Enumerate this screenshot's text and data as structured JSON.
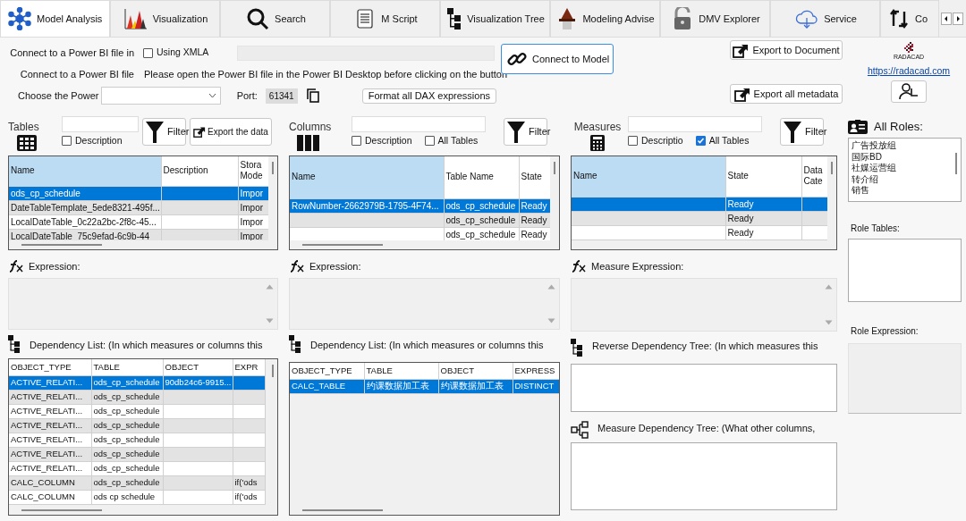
{
  "tabs": [
    {
      "label": "Model Analysis",
      "selected": true
    },
    {
      "label": "Visualization",
      "selected": false
    },
    {
      "label": "Search",
      "selected": false
    },
    {
      "label": "M Script",
      "selected": false
    },
    {
      "label": "Visualization Tree",
      "selected": false
    },
    {
      "label": "Modeling Advise",
      "selected": false
    },
    {
      "label": "DMV Explorer",
      "selected": false
    },
    {
      "label": "Service",
      "selected": false
    },
    {
      "label": "Co",
      "selected": false
    }
  ],
  "connection": {
    "file_in_label": "Connect to a Power BI file in",
    "xmla": {
      "label": "Using XMLA",
      "checked": false
    },
    "file_label": "Connect to a Power BI file",
    "instruction": "Please open the Power BI file in the Power BI Desktop before clicking on the button",
    "choose_label": "Choose the Power",
    "port_label": "Port:",
    "port": "61341",
    "connect_button": "Connect to Model",
    "format_button": "Format all DAX expressions"
  },
  "export": {
    "document_button": "Export to Document",
    "metadata_button": "Export all metadata"
  },
  "logo": {
    "text": "RADACAD",
    "link": "https://radacad.com"
  },
  "tables": {
    "label": "Tables",
    "checkboxes": [
      {
        "label": "Description",
        "checked": false
      }
    ],
    "buttons": [
      {
        "kind": "filter",
        "label": "Filter"
      },
      {
        "kind": "export",
        "label": "Export the data"
      }
    ],
    "grid": {
      "columns": [
        {
          "label": "Name",
          "highlighted": true
        },
        {
          "label": "Description",
          "highlighted": false
        },
        {
          "label": "Stora Mode",
          "highlighted": false
        }
      ],
      "rows": [
        {
          "cells": [
            "ods_cp_schedule",
            null,
            "Impor"
          ],
          "selected": true
        },
        {
          "cells": [
            "DateTableTemplate_5ede8321-495f...",
            null,
            "Impor"
          ],
          "selected": false
        },
        {
          "cells": [
            "LocalDateTable_0c22a2bc-2f8c-45...",
            null,
            "Impor"
          ],
          "selected": false
        },
        {
          "cells": [
            "LocalDateTable_75c9efad-6c9b-44",
            null,
            "Impor"
          ],
          "selected": false
        }
      ]
    },
    "expression_label": "Expression:",
    "dependency": {
      "label": "Dependency List: (In which measures or columns this",
      "grid": {
        "columns": [
          {
            "label": "OBJECT_TYPE",
            "highlighted": false
          },
          {
            "label": "TABLE",
            "highlighted": false
          },
          {
            "label": "OBJECT",
            "highlighted": false
          },
          {
            "label": "EXPR",
            "highlighted": false
          }
        ],
        "rows": [
          {
            "cells": [
              "ACTIVE_RELATI...",
              "ods_cp_schedule",
              "90db24c6-9915...",
              null
            ],
            "selected": true
          },
          {
            "cells": [
              "ACTIVE_RELATI...",
              "ods_cp_schedule",
              null,
              null
            ],
            "selected": false
          },
          {
            "cells": [
              "ACTIVE_RELATI...",
              "ods_cp_schedule",
              null,
              null
            ],
            "selected": false
          },
          {
            "cells": [
              "ACTIVE_RELATI...",
              "ods_cp_schedule",
              null,
              null
            ],
            "selected": false
          },
          {
            "cells": [
              "ACTIVE_RELATI...",
              "ods_cp_schedule",
              null,
              null
            ],
            "selected": false
          },
          {
            "cells": [
              "ACTIVE_RELATI...",
              "ods_cp_schedule",
              null,
              null
            ],
            "selected": false
          },
          {
            "cells": [
              "ACTIVE_RELATI...",
              "ods_cp_schedule",
              null,
              null
            ],
            "selected": false
          },
          {
            "cells": [
              "CALC_COLUMN",
              "ods_cp_schedule",
              null,
              "if('ods"
            ],
            "selected": false
          },
          {
            "cells": [
              "CALC_COLUMN",
              "ods cp schedule",
              null,
              "if('ods"
            ],
            "selected": false
          }
        ]
      }
    }
  },
  "columns": {
    "label": "Columns",
    "checkboxes": [
      {
        "label": "Description",
        "checked": false
      },
      {
        "label": "All Tables",
        "checked": false
      }
    ],
    "buttons": [
      {
        "kind": "filter",
        "label": "Filter"
      }
    ],
    "grid": {
      "columns": [
        {
          "label": "Name",
          "highlighted": true
        },
        {
          "label": "Table Name",
          "highlighted": false
        },
        {
          "label": "State",
          "highlighted": false
        }
      ],
      "rows": [
        {
          "cells": [
            "RowNumber-2662979B-1795-4F74...",
            "ods_cp_schedule",
            "Ready"
          ],
          "selected": true
        },
        {
          "cells": [
            null,
            "ods_cp_schedule",
            "Ready"
          ],
          "selected": false
        },
        {
          "cells": [
            null,
            "ods_cp_schedule",
            "Ready"
          ],
          "selected": false
        }
      ]
    },
    "expression_label": "Expression:",
    "dependency": {
      "label": "Dependency List: (In which measures or columns this",
      "grid": {
        "columns": [
          {
            "label": "OBJECT_TYPE",
            "highlighted": false
          },
          {
            "label": "TABLE",
            "highlighted": false
          },
          {
            "label": "OBJECT",
            "highlighted": false
          },
          {
            "label": "EXPRESS",
            "highlighted": false
          }
        ],
        "rows": [
          {
            "cells": [
              "CALC_TABLE",
              "约课数据加工表",
              "约课数据加工表",
              "DISTINCT"
            ],
            "selected": true
          }
        ]
      }
    }
  },
  "measures": {
    "label": "Measures",
    "checkboxes": [
      {
        "label": "Descriptio",
        "checked": false
      },
      {
        "label": "All Tables",
        "checked": true
      }
    ],
    "buttons": [
      {
        "kind": "filter",
        "label": "Filter"
      }
    ],
    "grid": {
      "columns": [
        {
          "label": "Name",
          "highlighted": true
        },
        {
          "label": "State",
          "highlighted": false
        },
        {
          "label": "Data Cate",
          "highlighted": false
        }
      ],
      "rows": [
        {
          "cells": [
            null,
            "Ready",
            null
          ],
          "selected": true
        },
        {
          "cells": [
            null,
            "Ready",
            null
          ],
          "selected": false
        },
        {
          "cells": [
            null,
            "Ready",
            null
          ],
          "selected": false
        }
      ]
    },
    "expression_label": "Measure Expression:",
    "reverse_tree_label": "Reverse Dependency Tree: (In which measures this",
    "measure_tree_label": "Measure Dependency Tree: (What other columns,"
  },
  "roles": {
    "label": "All Roles:",
    "items": [
      "广告投放组",
      "国际BD",
      "社媒运营组",
      "转介绍",
      "销售"
    ],
    "tables_label": "Role Tables:",
    "expression_label": "Role Expression:"
  }
}
